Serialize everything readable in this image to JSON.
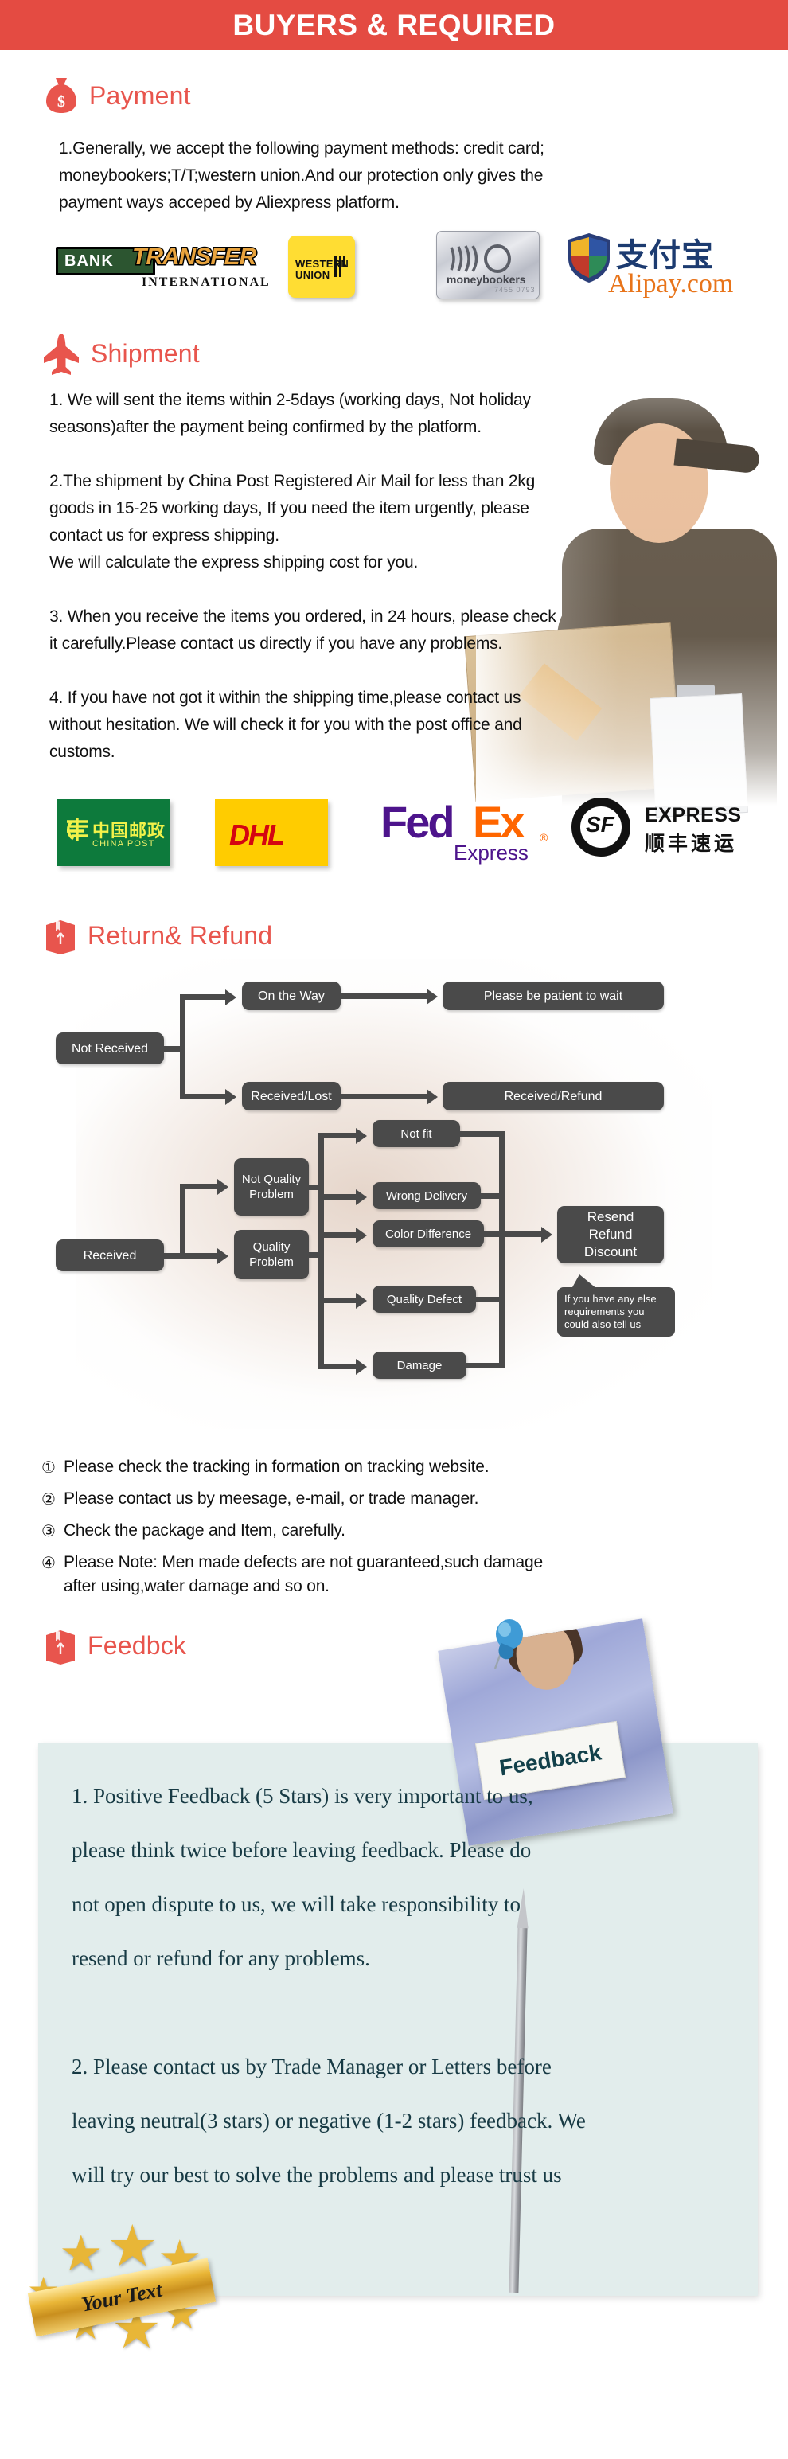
{
  "banner": {
    "title": "BUYERS & REQUIRED"
  },
  "sections": {
    "payment": {
      "heading": "Payment",
      "icon": "money-bag-icon",
      "body": "1.Generally, we accept the following payment methods: credit card;\nmoneybookers;T/T;western union.And our protection only gives the\npayment ways acceped by Aliexpress platform.",
      "logos": {
        "bank_transfer": {
          "word1": "BANK",
          "word2": "TRANSFER",
          "word3": "INTERNATIONAL"
        },
        "western_union": {
          "line1": "WESTERN",
          "line2": "UNION"
        },
        "moneybookers": {
          "name": "moneybookers",
          "number": "7455 0793"
        },
        "alipay": {
          "cn": "支付宝",
          "domain": "Alipay.com"
        }
      }
    },
    "shipment": {
      "heading": "Shipment",
      "icon": "airplane-icon",
      "body": "1. We will sent the items within 2-5days (working days, Not holiday\nseasons)after the payment being confirmed by the platform.\n\n2.The shipment by China Post Registered Air Mail for less than  2kg\ngoods in 15-25 working days, If  you need the item urgently, please\ncontact us for express shipping.\nWe will calculate the express shipping cost for you.\n\n3. When you receive the items you ordered, in 24 hours, please check\n it carefully.Please contact us directly if you have any problems.\n\n4. If you have not got it within the shipping time,please contact us\nwithout hesitation. We will check it for you with the post office and\ncustoms.",
      "carriers": {
        "china_post": {
          "cn": "中国邮政",
          "en": "CHINA POST"
        },
        "dhl": {
          "name": "DHL"
        },
        "fedex": {
          "fed": "Fed",
          "ex": "Ex",
          "reg": "®",
          "sub": "Express"
        },
        "sf_express": {
          "mark": "SF",
          "en": "EXPRESS",
          "cn": "顺丰速运"
        }
      }
    },
    "return_refund": {
      "heading": "Return& Refund",
      "icon": "package-box-icon",
      "flow": {
        "not_received": "Not Received",
        "on_the_way": "On the Way",
        "please_wait": "Please be patient to wait",
        "received_lost": "Received/Lost",
        "received_refund": "Received/Refund",
        "received": "Received",
        "not_quality_problem": "Not\nQuality\nProblem",
        "quality_problem": "Quality\nProblem",
        "not_fit": "Not fit",
        "wrong_delivery": "Wrong Delivery",
        "color_difference": "Color Difference",
        "quality_defect": "Quality Defect",
        "damage": "Damage",
        "resend": "Resend\nRefund\nDiscount",
        "bubble": "If you have any else\nrequirements you\ncould also tell us"
      },
      "notes": [
        {
          "num": "①",
          "text": "Please check the tracking in formation on tracking website."
        },
        {
          "num": "②",
          "text": "Please contact us by meesage, e-mail, or trade manager."
        },
        {
          "num": "③",
          "text": "Check the package and Item, carefully."
        },
        {
          "num": "④",
          "text": "Please Note: Men made defects  are not guaranteed,such damage\n    after using,water damage and so on."
        }
      ]
    },
    "feedback": {
      "heading": "Feedbck",
      "icon": "package-box-icon",
      "photo_sign_text": "Feedback",
      "body": "1. Positive Feedback (5 Stars) is very important to us,\nplease think twice before leaving feedback. Please do\nnot open dispute to us,   we will take responsibility to\nresend or refund for any problems.\n\n2. Please contact us by Trade Manager or Letters before\nleaving neutral(3 stars) or negative (1-2 stars) feedback. We\nwill try our best to solve the problems and please trust us",
      "badge_ribbon": "Your Text",
      "badge_star_glyph": "★"
    }
  },
  "colors": {
    "banner_bg": "#E44B42",
    "heading_red": "#E8554D",
    "flow_node": "#4a4a4a",
    "feedback_card": "#E2EDEC",
    "feedback_text": "#173A44"
  }
}
